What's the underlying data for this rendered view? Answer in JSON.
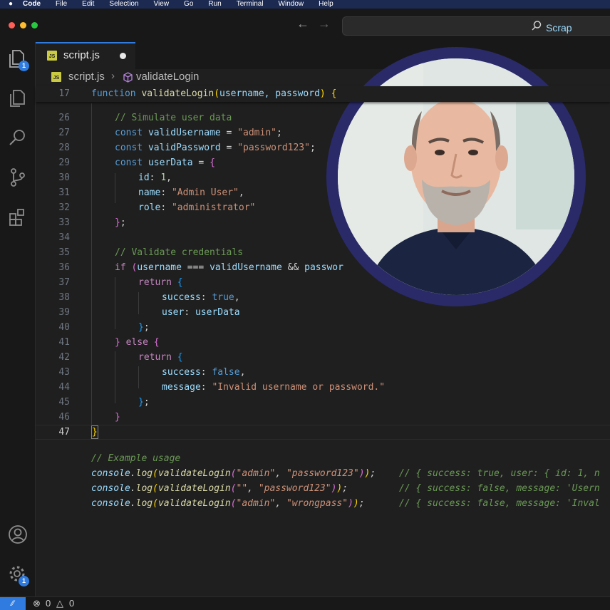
{
  "menubar": {
    "apple": "",
    "app": "Code",
    "items": [
      "File",
      "Edit",
      "Selection",
      "View",
      "Go",
      "Run",
      "Terminal",
      "Window",
      "Help"
    ]
  },
  "titlebar": {
    "search_text": "Scrap"
  },
  "activity": {
    "explorer_badge": "1",
    "settings_badge": "1"
  },
  "tab": {
    "label": "script.js",
    "file_type": "JS"
  },
  "breadcrumb": {
    "file": "script.js",
    "symbol": "validateLogin"
  },
  "sticky_line": {
    "number": "17",
    "code": "function validateLogin(username, password) {"
  },
  "code_lines": [
    {
      "n": "26",
      "text": "// Simulate user data"
    },
    {
      "n": "27",
      "text": "const validUsername = \"admin\";"
    },
    {
      "n": "28",
      "text": "const validPassword = \"password123\";"
    },
    {
      "n": "29",
      "text": "const userData = {"
    },
    {
      "n": "30",
      "text": "id: 1,"
    },
    {
      "n": "31",
      "text": "name: \"Admin User\","
    },
    {
      "n": "32",
      "text": "role: \"administrator\""
    },
    {
      "n": "33",
      "text": "};"
    },
    {
      "n": "34",
      "text": ""
    },
    {
      "n": "35",
      "text": "// Validate credentials"
    },
    {
      "n": "36",
      "text": "if (username === validUsername && passwor"
    },
    {
      "n": "37",
      "text": "return {"
    },
    {
      "n": "38",
      "text": "success: true,"
    },
    {
      "n": "39",
      "text": "user: userData"
    },
    {
      "n": "40",
      "text": "};"
    },
    {
      "n": "41",
      "text": "} else {"
    },
    {
      "n": "42",
      "text": "return {"
    },
    {
      "n": "43",
      "text": "success: false,"
    },
    {
      "n": "44",
      "text": "message: \"Invalid username or password.\""
    },
    {
      "n": "45",
      "text": "};"
    },
    {
      "n": "46",
      "text": "}"
    },
    {
      "n": "47",
      "text": "}"
    }
  ],
  "usage": {
    "comment": "// Example usage",
    "lines": [
      {
        "call": "console.log(validateLogin(\"admin\", \"password123\"));",
        "comment": "// { success: true, user: { id: 1, n"
      },
      {
        "call": "console.log(validateLogin(\"\", \"password123\"));",
        "comment": "// { success: false, message: 'Usern"
      },
      {
        "call": "console.log(validateLogin(\"admin\", \"wrongpass\"));",
        "comment": "// { success: false, message: 'Inval"
      }
    ]
  },
  "status": {
    "errors": "0",
    "warnings": "0"
  },
  "colors": {
    "accent": "#2f7be0",
    "avatar_ring": "#2a2a68"
  }
}
